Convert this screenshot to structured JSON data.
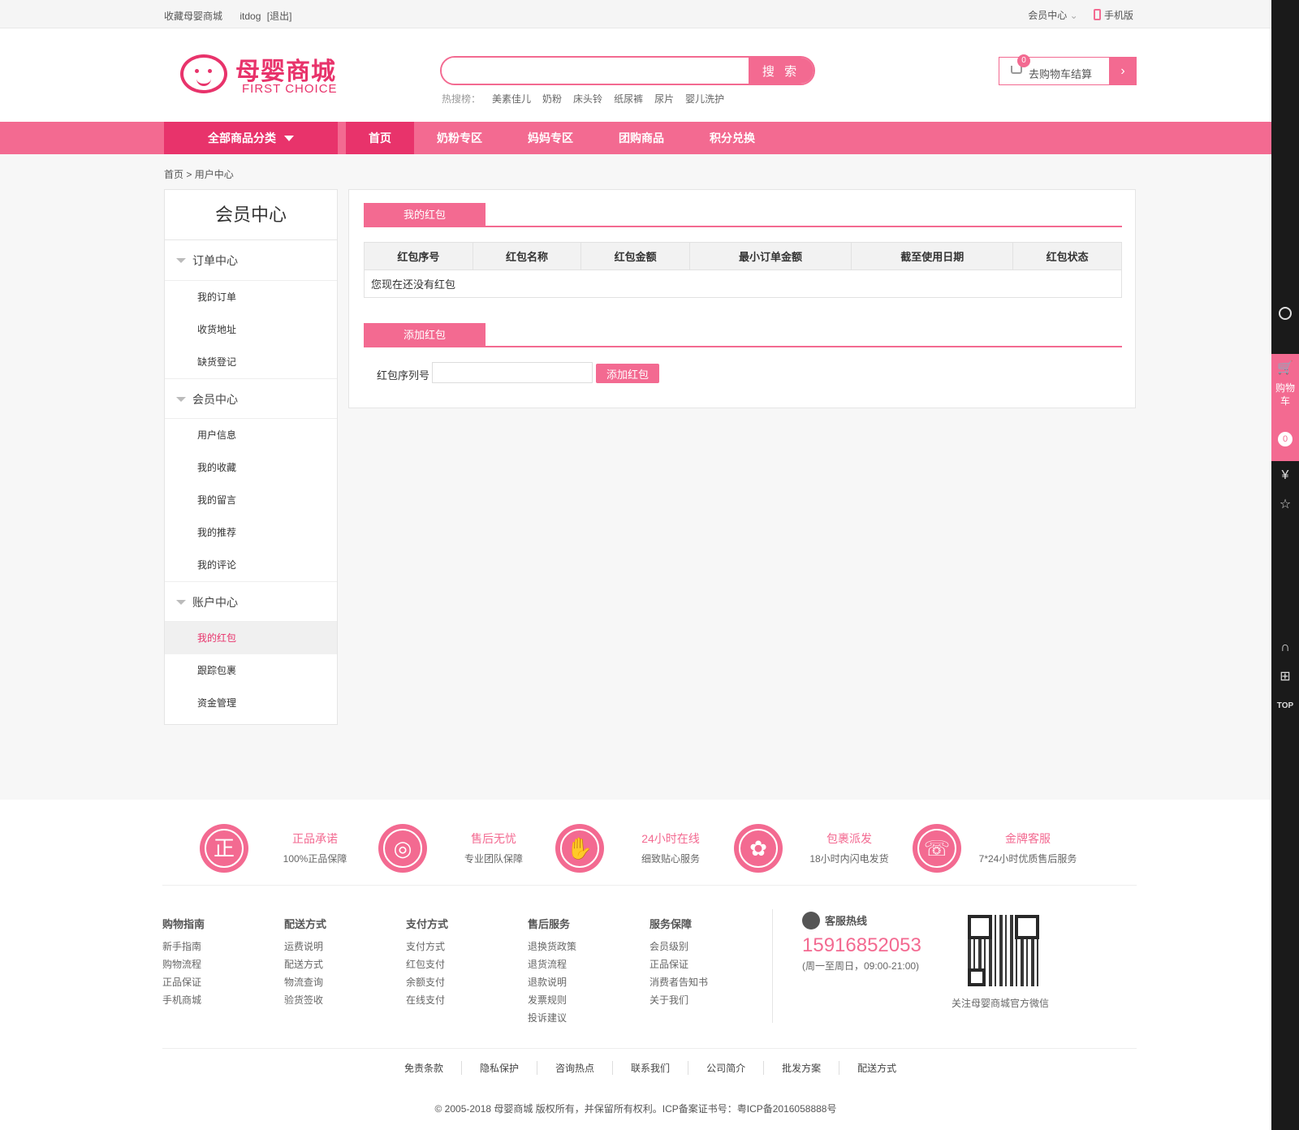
{
  "topbar": {
    "favorite": "收藏母婴商城",
    "user": "itdog",
    "logout": "[退出]",
    "member_center": "会员中心",
    "mobile": "手机版"
  },
  "logo": {
    "cn": "母婴商城",
    "en": "FIRST CHOICE"
  },
  "search": {
    "value": "",
    "button": "搜 索",
    "hot_label": "热搜榜：",
    "hot_keywords": [
      "美素佳儿",
      "奶粉",
      "床头铃",
      "纸尿裤",
      "尿片",
      "婴儿洗护"
    ]
  },
  "cart": {
    "count": "0",
    "label": "去购物车结算",
    "arrow": "›"
  },
  "nav": {
    "all_categories": "全部商品分类",
    "items": [
      "首页",
      "奶粉专区",
      "妈妈专区",
      "团购商品",
      "积分兑换"
    ]
  },
  "breadcrumb": {
    "home": "首页",
    "sep": ">",
    "current": "用户中心"
  },
  "sidebar": {
    "title": "会员中心",
    "groups": [
      {
        "label": "订单中心",
        "links": [
          "我的订单",
          "收货地址",
          "缺货登记"
        ]
      },
      {
        "label": "会员中心",
        "links": [
          "用户信息",
          "我的收藏",
          "我的留言",
          "我的推荐",
          "我的评论"
        ]
      },
      {
        "label": "账户中心",
        "links": [
          "我的红包",
          "跟踪包裹",
          "资金管理"
        ]
      }
    ]
  },
  "main": {
    "section1_title": "我的红包",
    "table_headers": [
      "红包序号",
      "红包名称",
      "红包金额",
      "最小订单金额",
      "截至使用日期",
      "红包状态"
    ],
    "empty_text": "您现在还没有红包",
    "section2_title": "添加红包",
    "serial_label": "红包序列号",
    "serial_value": "",
    "add_button": "添加红包"
  },
  "right_bar": {
    "cart_text": "购物车",
    "cart_count": "0",
    "top": "TOP"
  },
  "footer": {
    "guarantees": [
      {
        "title": "正品承诺",
        "sub": "100%正品保障",
        "icon": "正"
      },
      {
        "title": "售后无忧",
        "sub": "专业团队保障",
        "icon": "◎"
      },
      {
        "title": "24小时在线",
        "sub": "细致贴心服务",
        "icon": "✋"
      },
      {
        "title": "包裹派发",
        "sub": "18小时内闪电发货",
        "icon": "✿"
      },
      {
        "title": "金牌客服",
        "sub": "7*24小时优质售后服务",
        "icon": "☏"
      }
    ],
    "columns": [
      {
        "head": "购物指南",
        "links": [
          "新手指南",
          "购物流程",
          "正品保证",
          "手机商城"
        ]
      },
      {
        "head": "配送方式",
        "links": [
          "运费说明",
          "配送方式",
          "物流查询",
          "验货签收"
        ]
      },
      {
        "head": "支付方式",
        "links": [
          "支付方式",
          "红包支付",
          "余额支付",
          "在线支付"
        ]
      },
      {
        "head": "售后服务",
        "links": [
          "退换货政策",
          "退货流程",
          "退款说明",
          "发票规则",
          "投诉建议"
        ]
      },
      {
        "head": "服务保障",
        "links": [
          "会员级别",
          "正品保证",
          "消费者告知书",
          "关于我们"
        ]
      }
    ],
    "hotline_label": "客服热线",
    "hotline": "15916852053",
    "hours": "(周一至周日，09:00-21:00)",
    "qr_caption": "关注母婴商城官方微信",
    "bottom_links": [
      "免责条款",
      "隐私保护",
      "咨询热点",
      "联系我们",
      "公司简介",
      "批发方案",
      "配送方式"
    ],
    "copyright": "© 2005-2018 母婴商城 版权所有，并保留所有权利。ICP备案证书号：粤ICP备2016058888号"
  },
  "colors": {
    "accent": "#f36a91",
    "accent_dark": "#e8336b"
  }
}
